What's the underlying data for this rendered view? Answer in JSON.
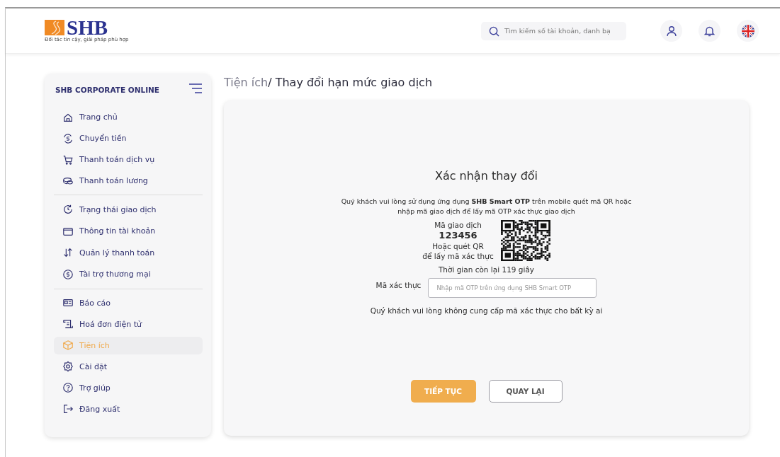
{
  "header": {
    "logo_text": "SHB",
    "tagline": "Đối tác tin cậy, giải pháp phù hợp",
    "search": {
      "placeholder": "Tìm kiếm số tài khoản, danh bạ"
    }
  },
  "sidebar": {
    "title": "SHB CORPORATE ONLINE",
    "groups": [
      [
        {
          "label": "Trang chủ",
          "selected": false
        },
        {
          "label": "Chuyển tiền",
          "selected": false
        },
        {
          "label": "Thanh toán dịch vụ",
          "selected": false
        },
        {
          "label": "Thanh toán lương",
          "selected": false
        }
      ],
      [
        {
          "label": "Trạng thái giao dịch",
          "selected": false
        },
        {
          "label": "Thông tin tài khoản",
          "selected": false
        },
        {
          "label": "Quản lý thanh toán",
          "selected": false
        },
        {
          "label": "Tài trợ thương mại",
          "selected": false
        }
      ],
      [
        {
          "label": "Báo cáo",
          "selected": false
        },
        {
          "label": "Hoá đơn điện tử",
          "selected": false
        },
        {
          "label": "Tiện ích",
          "selected": true
        },
        {
          "label": "Cài đặt",
          "selected": false
        },
        {
          "label": "Trợ giúp",
          "selected": false
        },
        {
          "label": "Đăng xuất",
          "selected": false
        }
      ]
    ]
  },
  "breadcrumb": {
    "parent": "Tiện ích",
    "current": "/ Thay đổi hạn mức giao dịch"
  },
  "confirm": {
    "title": "Xác nhận thay đổi",
    "instruction": "Quý khách vui lòng sử dụng ứng dụng **SHB Smart OTP** trên mobile quét mã QR hoặc nhập mã giao dịch để lấy mã OTP xác thực giao dịch",
    "code_label": "Mã giao dịch",
    "code": "123456",
    "qr_hint_1": "Hoặc quét QR",
    "qr_hint_2": "để lấy mã xác thực",
    "timer": "Thời gian còn lại 119 giây",
    "otp_label": "Mã xác thực",
    "otp_placeholder": "Nhập mã OTP trên ứng dụng SHB Smart OTP",
    "warning": "Quý khách vui lòng không cung cấp mã xác thực cho bất kỳ ai"
  },
  "buttons": [
    {
      "label": "TIẾP TỤC",
      "kind": "primary"
    },
    {
      "label": "QUAY LẠI",
      "kind": "secondary"
    }
  ]
}
